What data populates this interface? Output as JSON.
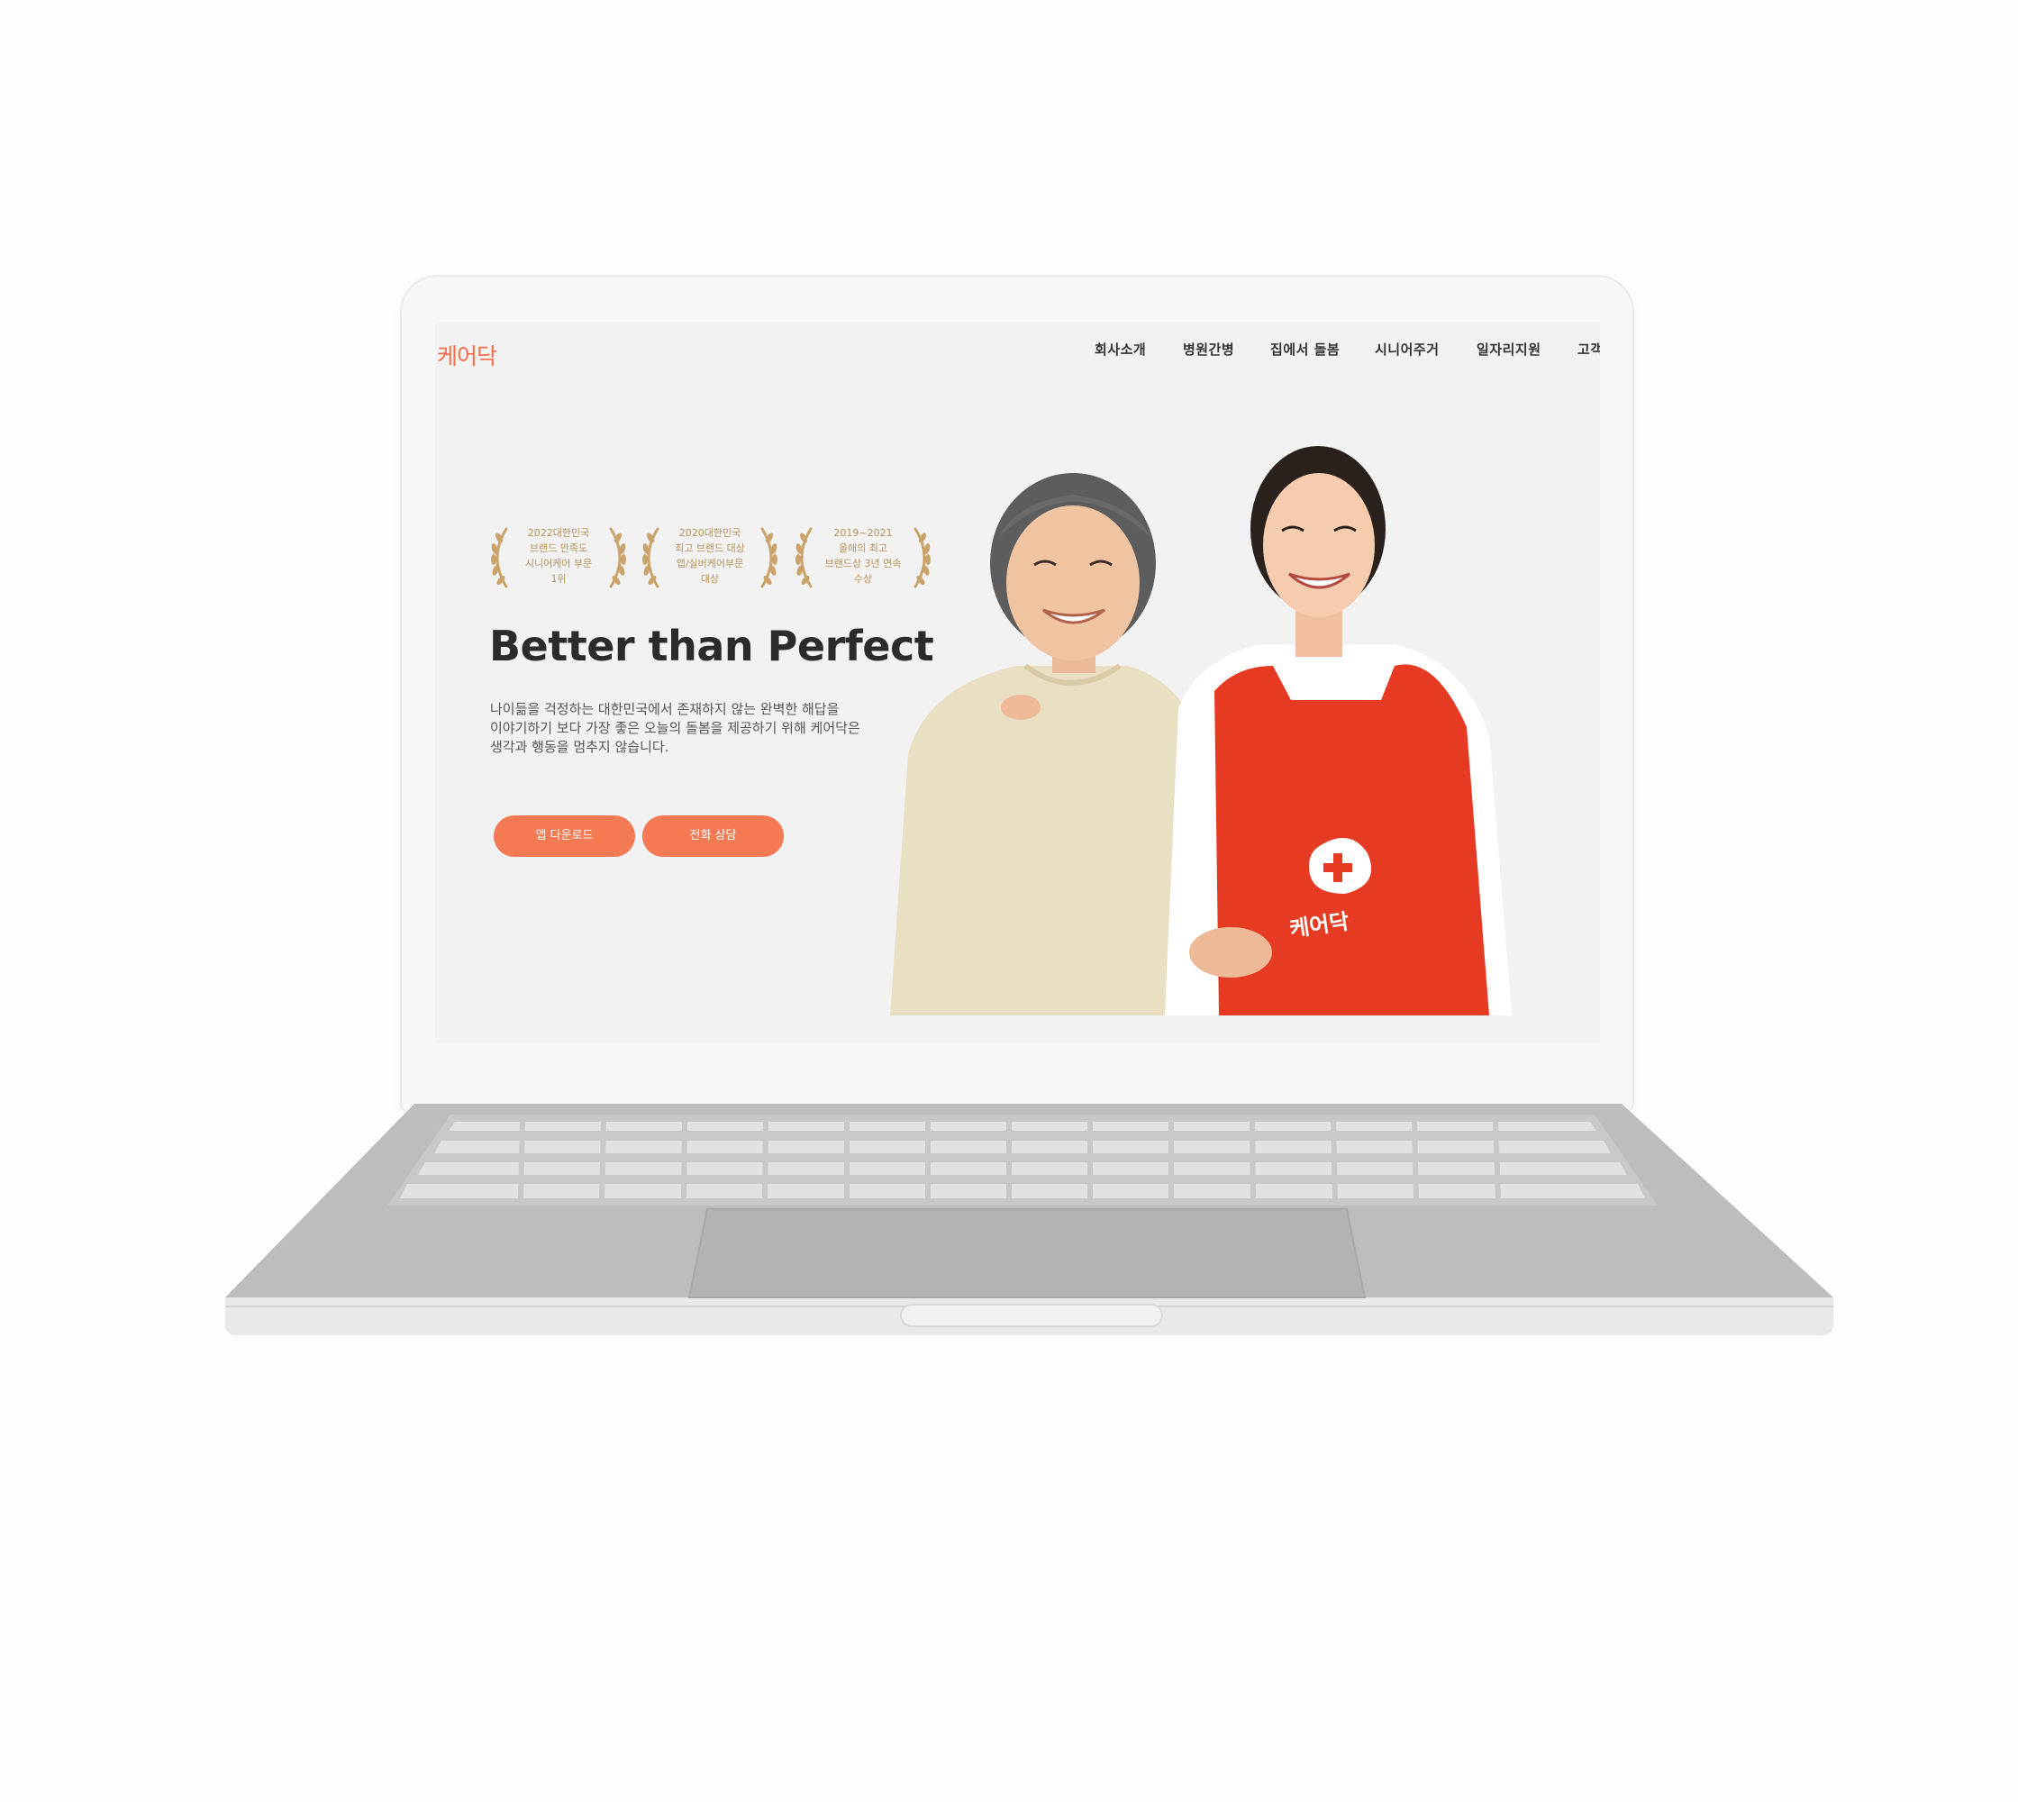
{
  "site": {
    "logo": "케어닥",
    "nav": [
      "회사소개",
      "병원간병",
      "집에서 돌봄",
      "시니어주거",
      "일자리지원",
      "고객"
    ]
  },
  "awards": [
    {
      "lines": [
        "2022대한민국",
        "브랜드 만족도",
        "시니어케어 부문",
        "1위"
      ]
    },
    {
      "lines": [
        "2020대한민국",
        "최고 브랜드 대상",
        "앱/실버케어부문",
        "대상"
      ]
    },
    {
      "lines": [
        "2019~2021",
        "올해의 최고",
        "브랜드상 3년 연속",
        "수상"
      ]
    }
  ],
  "hero": {
    "headline": "Better than Perfect",
    "description": [
      "나이듦을 걱정하는 대한민국에서 존재하지 않는 완벽한 해답을",
      "이야기하기 보다 가장 좋은 오늘의 돌봄을 제공하기 위해 케어닥은",
      "생각과 행동을 멈추지 않습니다."
    ],
    "buttons": {
      "app_download": "앱 다운로드",
      "phone_consult": "전화 상담"
    }
  },
  "photo": {
    "apron_logo": "케어닥"
  },
  "colors": {
    "brand_orange": "#f47a53",
    "award_gold": "#b89256",
    "apron_red": "#e63b22"
  },
  "icons": [
    "laurel-icon",
    "plus-cross-icon"
  ]
}
